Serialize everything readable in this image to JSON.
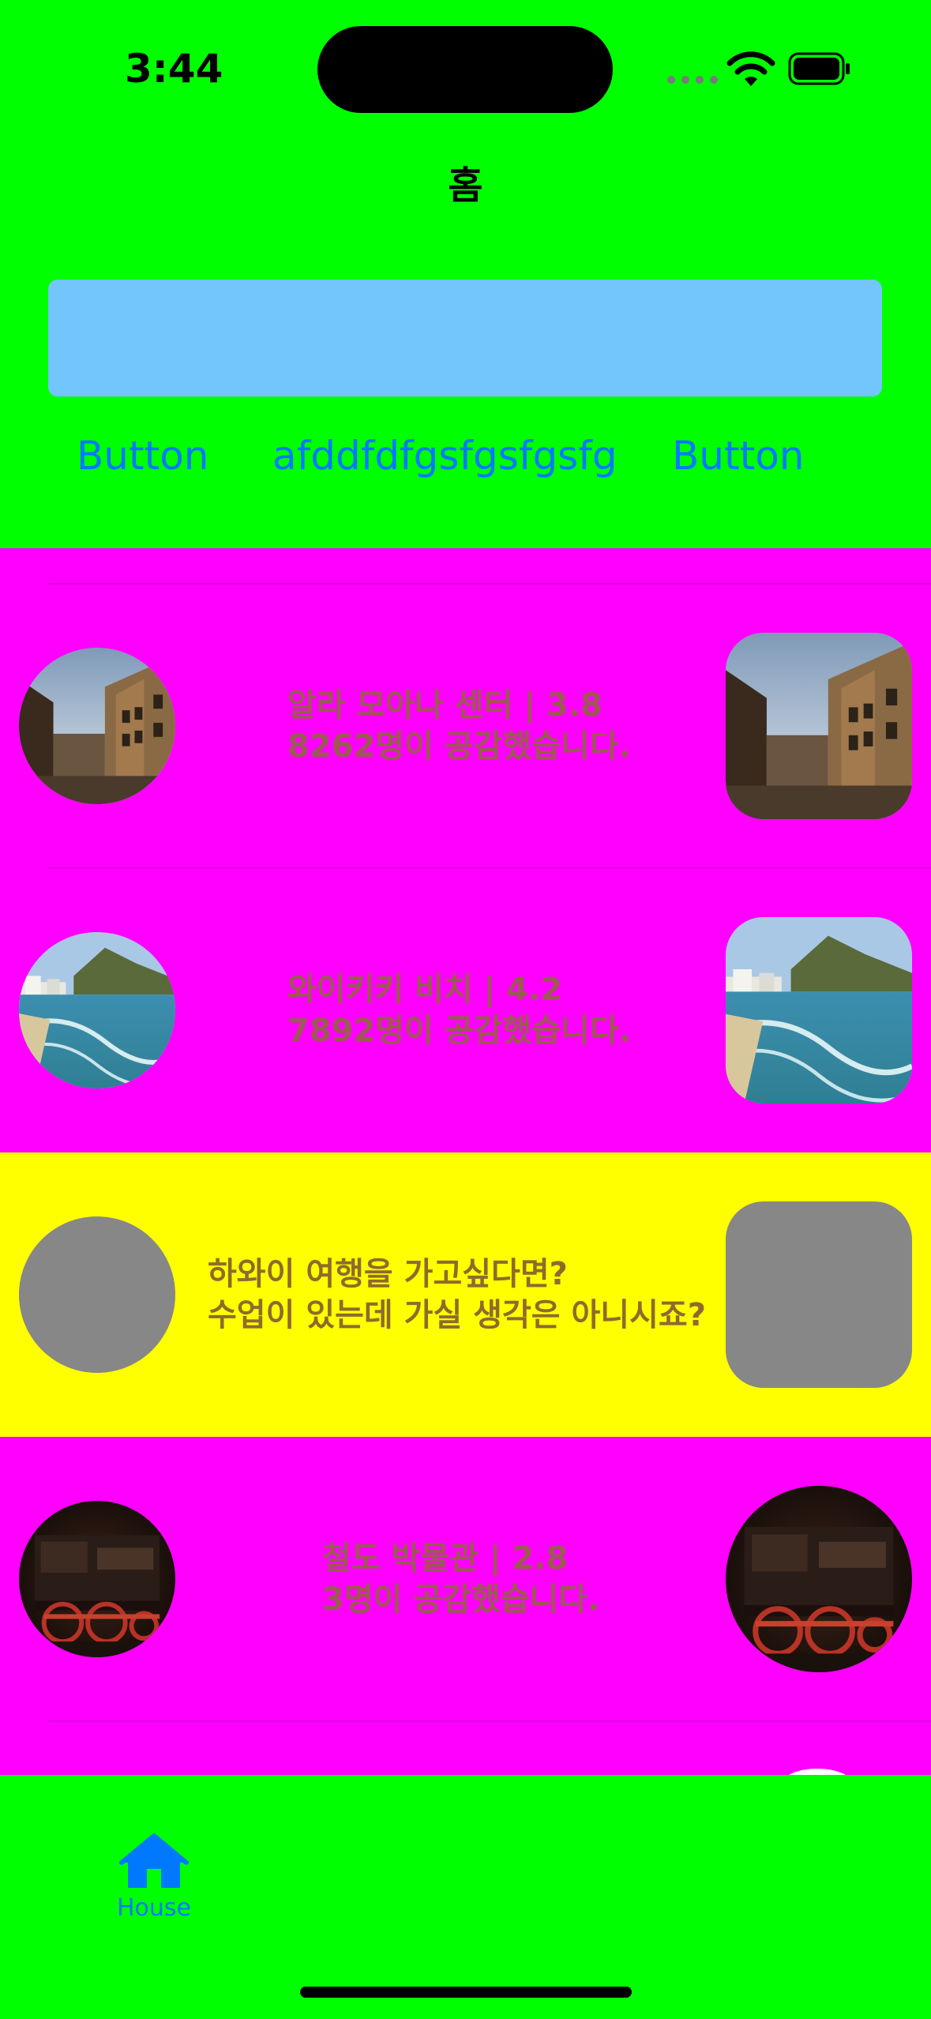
{
  "status_bar": {
    "time": "3:44"
  },
  "nav": {
    "title": "홈"
  },
  "search": {
    "placeholder": ""
  },
  "buttons": [
    "Button",
    "afddfdfgsfgsfgsfg",
    "Button"
  ],
  "list": {
    "rows": [
      {
        "line1": "알라 모아나 센터 | 3.8",
        "line2": "8262명이 공감했습니다.",
        "image": "street-photo"
      },
      {
        "line1": "와이키키 비치 | 4.2",
        "line2": "7892명이 공감했습니다.",
        "image": "beach-photo"
      },
      {
        "line1": "하와이 여행을 가고싶다면?",
        "line2": "수업이 있는데 가실 생각은 아니시죠?",
        "image": "placeholder-gray",
        "highlight": "#ffff00"
      },
      {
        "line1": "철도 박물관 | 2.8",
        "line2": "3명이 공감했습니다.",
        "image": "train-photo"
      }
    ]
  },
  "tabbar": {
    "tabs": [
      {
        "label": "House",
        "icon": "house-icon"
      }
    ]
  },
  "colors": {
    "background": "#00ff00",
    "list_bg": "#ff00ff",
    "search_bg": "#72c6fb",
    "accent": "#0079ff",
    "highlight_row": "#ffff00"
  }
}
